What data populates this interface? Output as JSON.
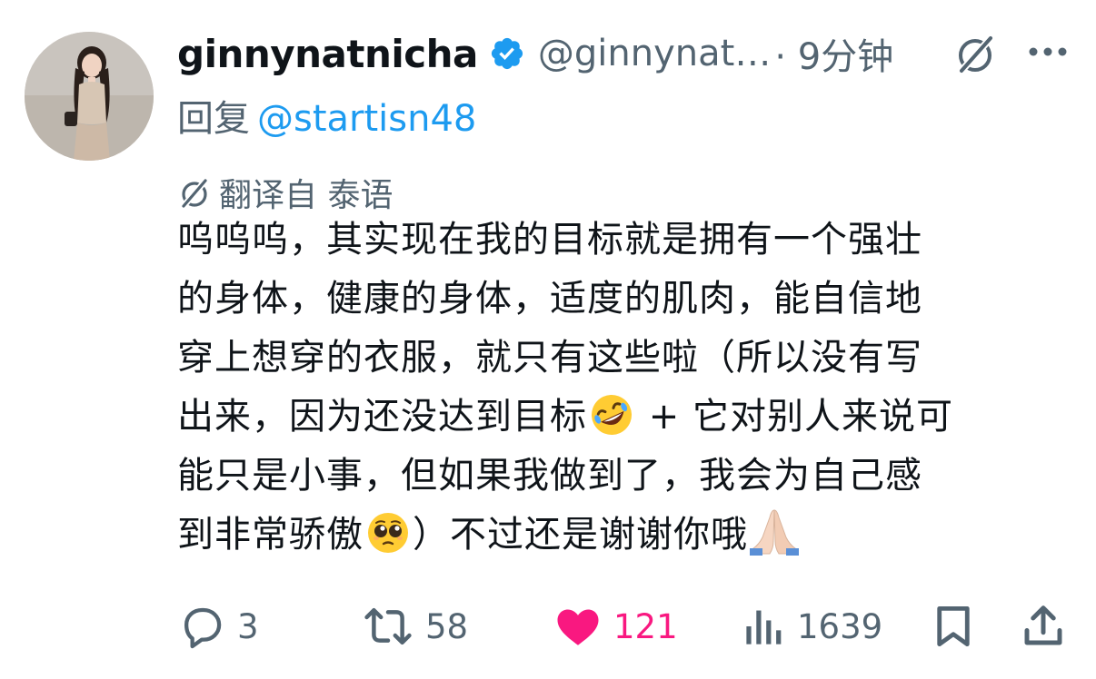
{
  "tweet": {
    "display_name": "ginnynatnicha",
    "handle": "@ginnynat…",
    "time": "· 9分钟",
    "reply_prefix": "回复",
    "reply_mention": "@startisn48",
    "translated_label": "翻译自 泰语",
    "body_lines": [
      "呜呜呜，其实现在我的目标就是拥有一个强壮",
      "的身体，健康的身体，适度的肌肉，能自信地",
      "穿上想穿的衣服，就只有这些啦（所以没有写",
      "出来，因为还没达到目标",
      " + 它对别人来说可",
      "能只是小事，但如果我做到了，我会为自己感",
      "到非常骄傲",
      "）不过还是谢谢你哦"
    ],
    "icons": {
      "verified": "verified-badge-icon",
      "grok": "grok-icon",
      "more": "more-icon",
      "translate": "translate-icon",
      "emoji_1": "rofl-emoji",
      "emoji_2": "pleading-emoji",
      "emoji_3": "folded-hands-emoji"
    }
  },
  "actions": {
    "replies": "3",
    "retweets": "58",
    "likes": "121",
    "views": "1639"
  },
  "colors": {
    "accent": "#1d9bf0",
    "like": "#f91880",
    "muted": "#536471",
    "text": "#0f1419"
  }
}
